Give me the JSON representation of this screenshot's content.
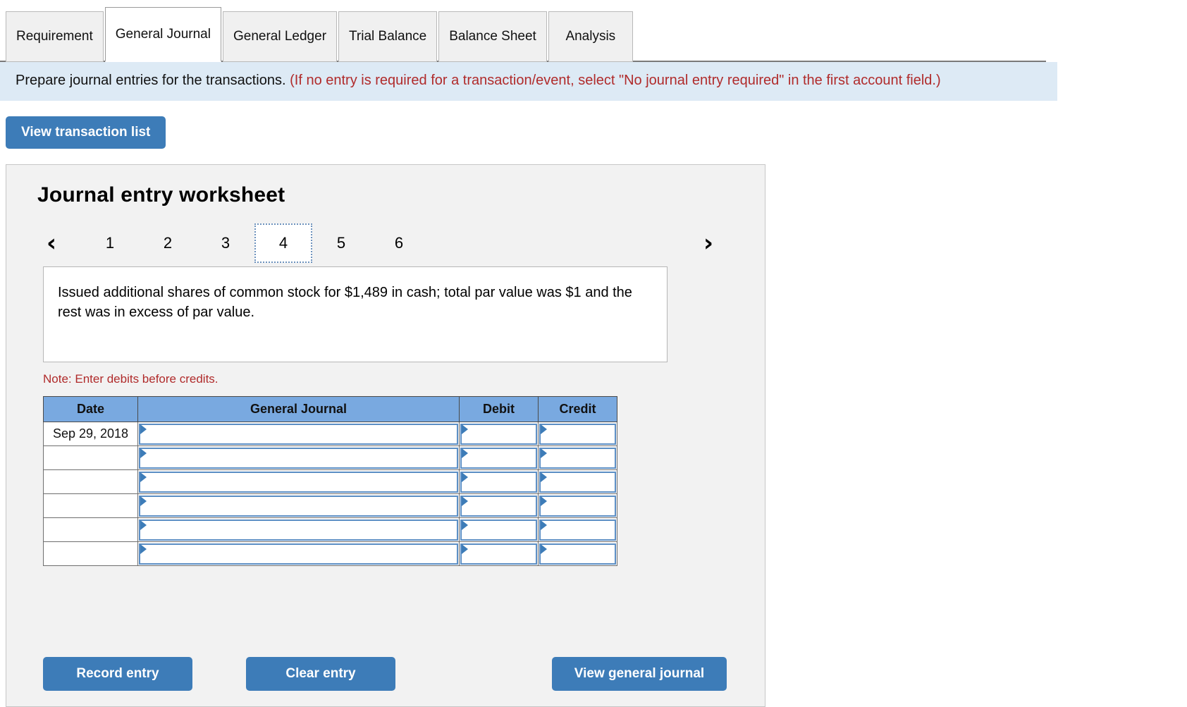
{
  "tabs": [
    {
      "label": "Requirement",
      "active": false
    },
    {
      "label": "General Journal",
      "active": true
    },
    {
      "label": "General Ledger",
      "active": false
    },
    {
      "label": "Trial Balance",
      "active": false
    },
    {
      "label": "Balance Sheet",
      "active": false
    },
    {
      "label": "Analysis",
      "active": false
    }
  ],
  "banner": {
    "lead": "Prepare journal entries for the transactions.",
    "hint": "(If no entry is required for a transaction/event, select \"No journal entry required\" in the first account field.)"
  },
  "toolbar": {
    "view_transaction_list": "View transaction list"
  },
  "worksheet": {
    "title": "Journal entry worksheet",
    "pager": {
      "prev_icon": "‹",
      "next_icon": "›",
      "pages": [
        "1",
        "2",
        "3",
        "4",
        "5",
        "6"
      ],
      "current": "4"
    },
    "transaction_text": "Issued additional shares of common stock for $1,489 in cash; total par value was $1 and the rest was in excess of par value.",
    "note": "Note: Enter debits before credits.",
    "table": {
      "headers": [
        "Date",
        "General Journal",
        "Debit",
        "Credit"
      ],
      "rows": [
        {
          "date": "Sep 29, 2018",
          "account": "",
          "debit": "",
          "credit": ""
        },
        {
          "date": "",
          "account": "",
          "debit": "",
          "credit": ""
        },
        {
          "date": "",
          "account": "",
          "debit": "",
          "credit": ""
        },
        {
          "date": "",
          "account": "",
          "debit": "",
          "credit": ""
        },
        {
          "date": "",
          "account": "",
          "debit": "",
          "credit": ""
        },
        {
          "date": "",
          "account": "",
          "debit": "",
          "credit": ""
        }
      ]
    },
    "buttons": {
      "record_entry": "Record entry",
      "clear_entry": "Clear entry",
      "view_general_journal": "View general journal"
    }
  },
  "colors": {
    "accent_blue": "#3d7cb8",
    "table_header_blue": "#79a9e0",
    "banner_bg": "#ddeaf5",
    "warning_red": "#b02b2b",
    "panel_bg": "#f2f2f2"
  }
}
